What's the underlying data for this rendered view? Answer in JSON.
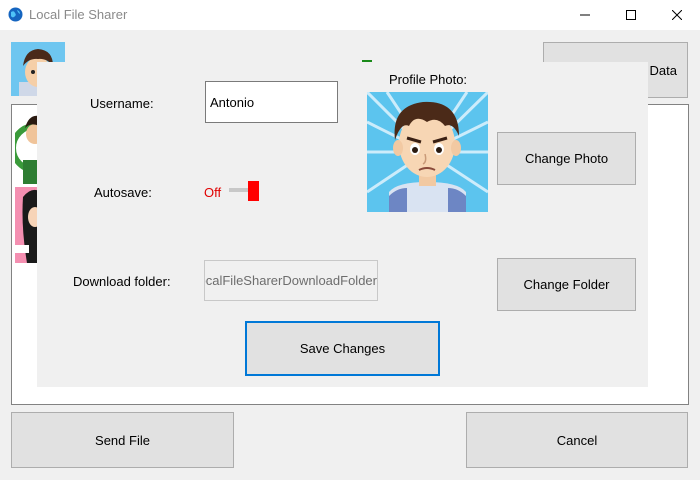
{
  "window": {
    "title": "Local File Sharer",
    "controls": [
      "minimize-icon",
      "maximize-icon",
      "close-icon"
    ]
  },
  "background": {
    "data_button_label": "Data",
    "send_file_label": "Send File",
    "cancel_label": "Cancel"
  },
  "settings": {
    "username_label": "Username:",
    "username_value": "Antonio",
    "autosave_label": "Autosave:",
    "autosave_state": "Off",
    "download_label": "Download folder:",
    "download_value": "LocalFileSharerDownloadFolder",
    "profile_photo_label": "Profile Photo:",
    "change_photo_label": "Change Photo",
    "change_folder_label": "Change Folder",
    "save_changes_label": "Save Changes"
  },
  "colors": {
    "accent": "#0078d7",
    "toggle_off": "#ff0000",
    "panel_bg": "#f0f0f0"
  }
}
